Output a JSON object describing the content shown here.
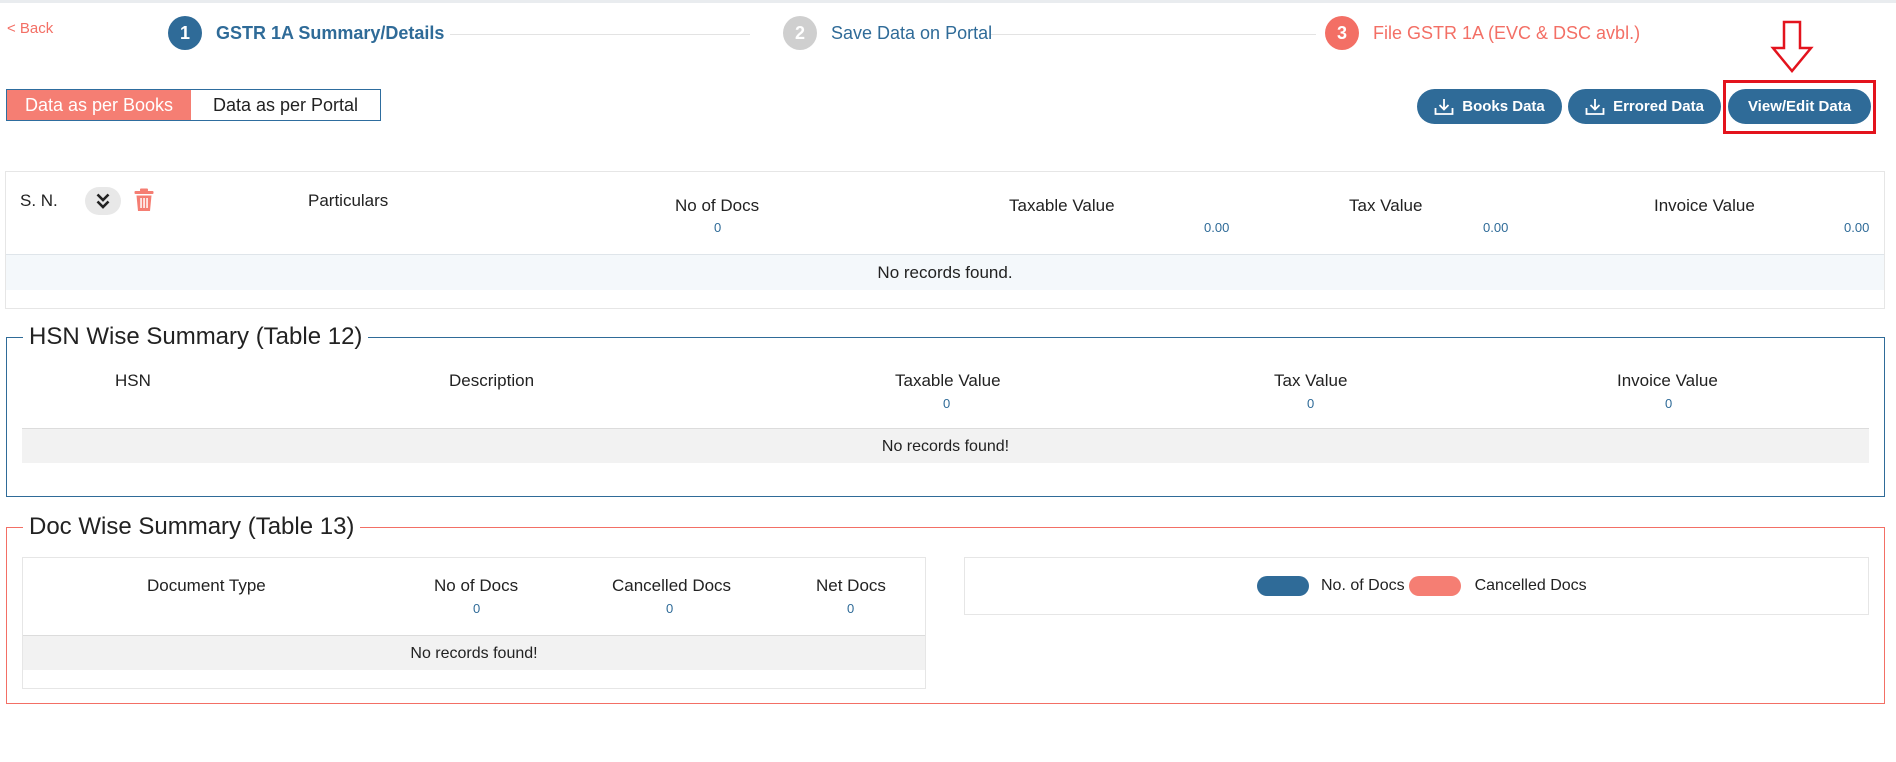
{
  "nav": {
    "back_label": "< Back"
  },
  "stepper": {
    "steps": [
      {
        "num": "1",
        "label": "GSTR 1A Summary/Details",
        "color": "#2f6b98"
      },
      {
        "num": "2",
        "label": "Save Data on Portal",
        "color": "#cfcfcf"
      },
      {
        "num": "3",
        "label": "File GSTR 1A (EVC & DSC avbl.)",
        "color": "#f36f65"
      }
    ]
  },
  "view_toggle": {
    "active": "Data as per Books",
    "inactive": "Data as per Portal"
  },
  "actions": {
    "books": "Books Data",
    "errored": "Errored Data",
    "view_edit": "View/Edit Data"
  },
  "main_table": {
    "headers": {
      "sn": "S. N.",
      "particulars": "Particulars",
      "no_of_docs": "No of Docs",
      "taxable_value": "Taxable Value",
      "tax_value": "Tax Value",
      "invoice_value": "Invoice Value"
    },
    "totals": {
      "no_of_docs": "0",
      "taxable_value": "0.00",
      "tax_value": "0.00",
      "invoice_value": "0.00"
    },
    "empty": "No records found."
  },
  "hsn_summary": {
    "title": "HSN Wise Summary (Table 12)",
    "headers": {
      "hsn": "HSN",
      "description": "Description",
      "taxable_value": "Taxable Value",
      "tax_value": "Tax Value",
      "invoice_value": "Invoice Value"
    },
    "totals": {
      "taxable_value": "0",
      "tax_value": "0",
      "invoice_value": "0"
    },
    "empty": "No records found!"
  },
  "doc_summary": {
    "title": "Doc Wise Summary (Table 13)",
    "headers": {
      "document_type": "Document Type",
      "no_of_docs": "No of Docs",
      "cancelled_docs": "Cancelled Docs",
      "net_docs": "Net Docs"
    },
    "totals": {
      "no_of_docs": "0",
      "cancelled_docs": "0",
      "net_docs": "0"
    },
    "empty": "No records found!",
    "chart_legend": [
      {
        "label": "No. of Docs",
        "color": "#2f6b98"
      },
      {
        "label": "Cancelled Docs",
        "color": "#f57e73"
      }
    ]
  }
}
